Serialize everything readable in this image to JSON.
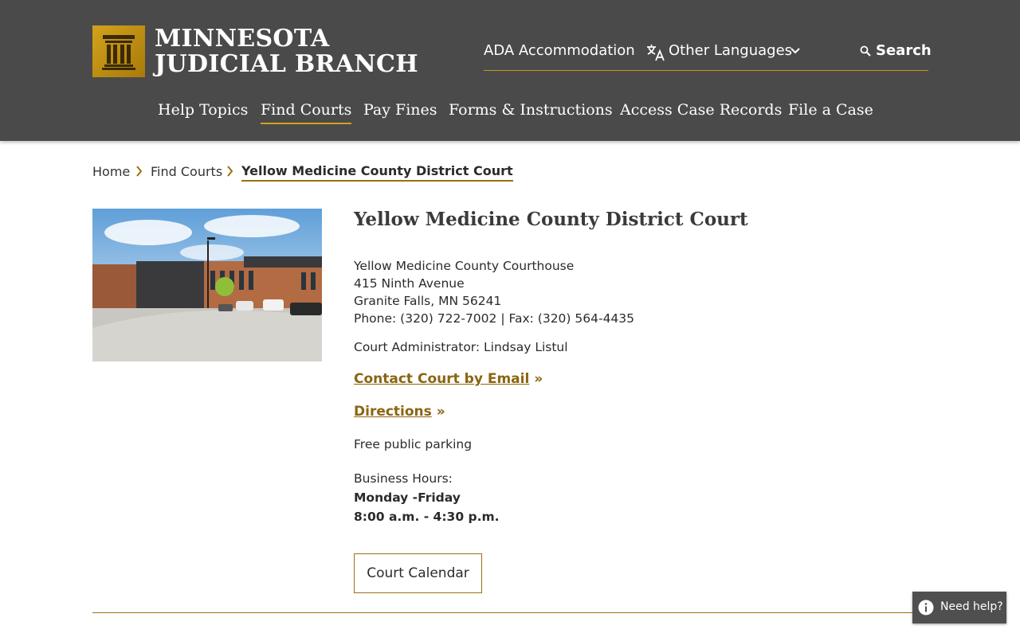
{
  "header": {
    "logo_line1": "MINNESOTA",
    "logo_line2": "JUDICIAL BRANCH",
    "ada_label": "ADA Accommodation",
    "languages_label": "Other Languages",
    "search_label": "Search"
  },
  "nav": {
    "items": [
      "Help Topics",
      "Find Courts",
      "Pay Fines",
      "Forms & Instructions",
      "Access Case Records",
      "File a Case"
    ],
    "active": "Find Courts"
  },
  "breadcrumb": {
    "home": "Home",
    "find_courts": "Find Courts",
    "current": "Yellow Medicine County District Court"
  },
  "court": {
    "title": "Yellow Medicine County District Court",
    "building": "Yellow Medicine County Courthouse",
    "street": "415 Ninth Avenue",
    "city": "Granite Falls, MN 56241",
    "phone_fax": "Phone: (320) 722-7002 | Fax: (320) 564-4435",
    "administrator": "Court Administrator: Lindsay Listul",
    "email_link": "Contact Court by Email",
    "directions_link": "Directions",
    "link_suffix": "»",
    "parking": "Free public parking",
    "hours_label": "Business Hours:",
    "hours_days": "Monday -Friday",
    "hours_time": "8:00 a.m. - 4:30 p.m.",
    "calendar_button": "Court Calendar"
  },
  "help_widget": {
    "label": "Need help?"
  },
  "colors": {
    "header_bg": "#4a4a4a",
    "accent_gold": "#d3a21b",
    "link_gold": "#8a6510"
  }
}
